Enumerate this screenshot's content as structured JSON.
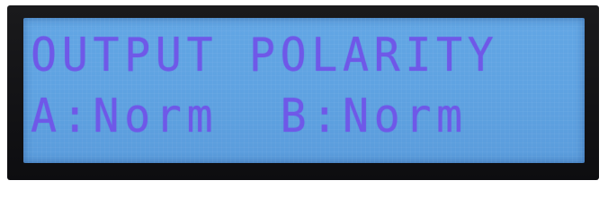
{
  "lcd": {
    "line1": "OUTPUT POLARITY",
    "line2": "A:Norm  B:Norm"
  },
  "colors": {
    "backlight": "#5fa3e2",
    "text": "#6f58e8",
    "bezel": "#111114"
  }
}
